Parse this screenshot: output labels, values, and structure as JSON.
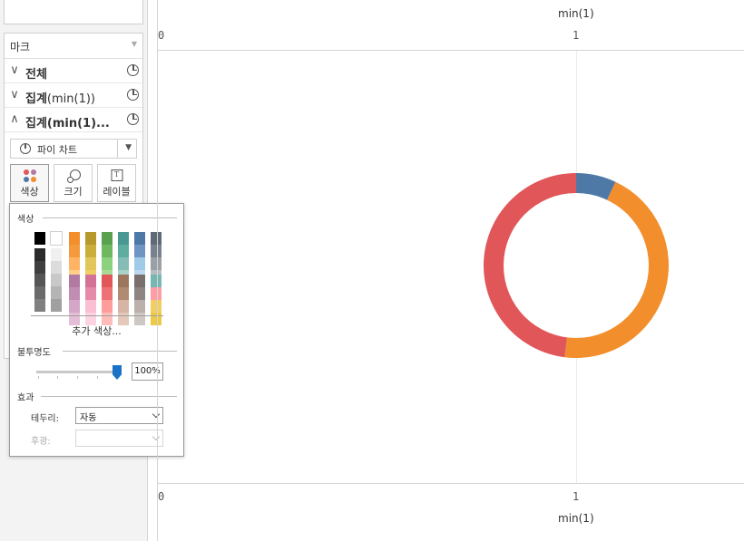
{
  "marks_panel": {
    "title": "마크",
    "rows": [
      {
        "label": "전체",
        "sub": "",
        "chevron": "∨"
      },
      {
        "label": "집계",
        "sub": "(min(1))",
        "chevron": "∨"
      },
      {
        "label": "집계(min(1)...",
        "sub": "",
        "chevron": "∧"
      }
    ],
    "mark_type": "파이 차트",
    "buttons": {
      "color": "색상",
      "size": "크기",
      "label": "레이블"
    },
    "icons": [
      "pie-chart-icon",
      "color-dots-icon",
      "size-icon",
      "label-text-icon",
      "chevron-down-icon",
      "chevron-up-icon"
    ]
  },
  "color_popup": {
    "color_section": "색상",
    "more_colors": "추가 색상...",
    "opacity_section": "불투명도",
    "opacity_value": "100%",
    "opacity_fraction": 1.0,
    "effects_section": "효과",
    "border_label": "테두리:",
    "border_value": "자동",
    "halo_label": "후광:",
    "halo_value": "",
    "grayscale": [
      "#000000",
      "#2b2b2b",
      "#3f3f3f",
      "#555555",
      "#6b6b6b",
      "#808080"
    ],
    "grayscale_light": [
      "#ffffff",
      "#f0f0f0",
      "#dcdcdc",
      "#c8c8c8",
      "#b4b4b4",
      "#a0a0a0"
    ],
    "palette_top": [
      [
        "#f28e2b",
        "#f59a3c",
        "#ffb365",
        "#ffcf8a"
      ],
      [
        "#b6992d",
        "#cbad3c",
        "#e1c65b",
        "#f1ce63"
      ],
      [
        "#59a14f",
        "#6eb85f",
        "#8cd17d",
        "#a6da95"
      ],
      [
        "#499894",
        "#5ead9f",
        "#86bcb6",
        "#a9d3c9"
      ],
      [
        "#4e79a7",
        "#6f95c2",
        "#a0cbe8",
        "#bdd7ee"
      ],
      [
        "#606a75",
        "#79828c",
        "#9aa0a6",
        "#b7bcc1"
      ]
    ],
    "palette_bottom": [
      [
        "#b07aa1",
        "#c28db3",
        "#d4a6c8",
        "#e3bed6"
      ],
      [
        "#d37295",
        "#e58aa9",
        "#fabfd2",
        "#fcd3e0"
      ],
      [
        "#e15759",
        "#ee7175",
        "#ff9d9a",
        "#ffbcb9"
      ],
      [
        "#9d7660",
        "#b08a73",
        "#d7b5a6",
        "#e3c8bb"
      ],
      [
        "#79706e",
        "#8e8583",
        "#bab0ac",
        "#cfc7c4"
      ],
      [
        "#76b7b2",
        "#ff9da7",
        "#f1ce63",
        "#edc948"
      ]
    ]
  },
  "chart": {
    "top_axis_title": "min(1)",
    "bottom_axis_title": "min(1)",
    "top_ticks": [
      "0",
      "1"
    ],
    "bottom_ticks": [
      "0",
      "1"
    ]
  },
  "chart_data": {
    "type": "pie",
    "donut": true,
    "slices": [
      {
        "color": "#4e79a7",
        "fraction": 0.07
      },
      {
        "color": "#f28e2b",
        "fraction": 0.45
      },
      {
        "color": "#e15759",
        "fraction": 0.48
      }
    ],
    "x_ticks": [
      "0",
      "1"
    ],
    "xlim": [
      0,
      1
    ]
  }
}
